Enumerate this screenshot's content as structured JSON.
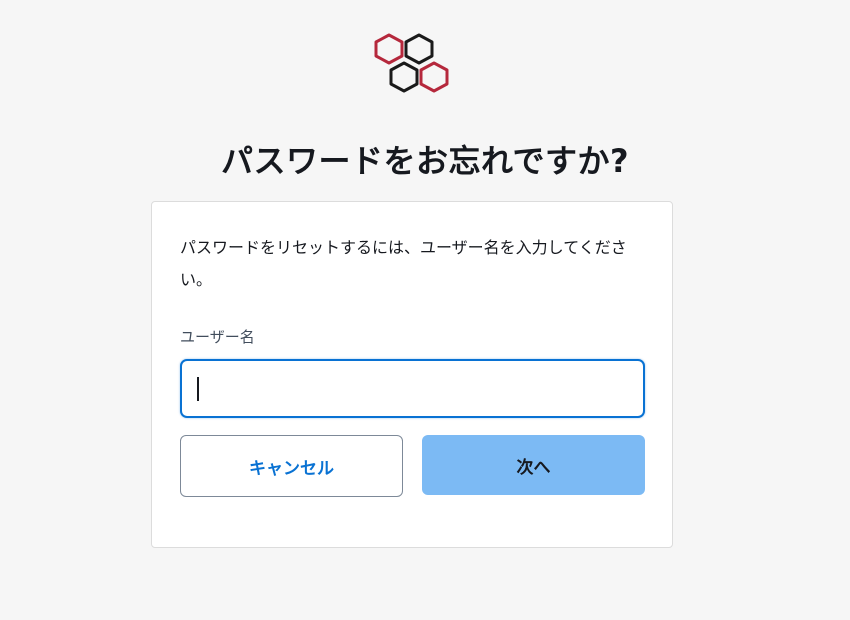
{
  "logo": {
    "icon": "honeycomb-logo-icon",
    "colors": {
      "outline_dark": "#1a1a1a",
      "outline_accent": "#b5283c"
    }
  },
  "page": {
    "title": "パスワードをお忘れですか?"
  },
  "form": {
    "instructions": "パスワードをリセットするには、ユーザー名を入力してください。",
    "username_label": "ユーザー名",
    "username_value": "",
    "username_placeholder": "",
    "cancel_label": "キャンセル",
    "next_label": "次へ"
  },
  "colors": {
    "background": "#f6f6f6",
    "accent": "#0972d3",
    "next_button": "#7cbaf4"
  }
}
